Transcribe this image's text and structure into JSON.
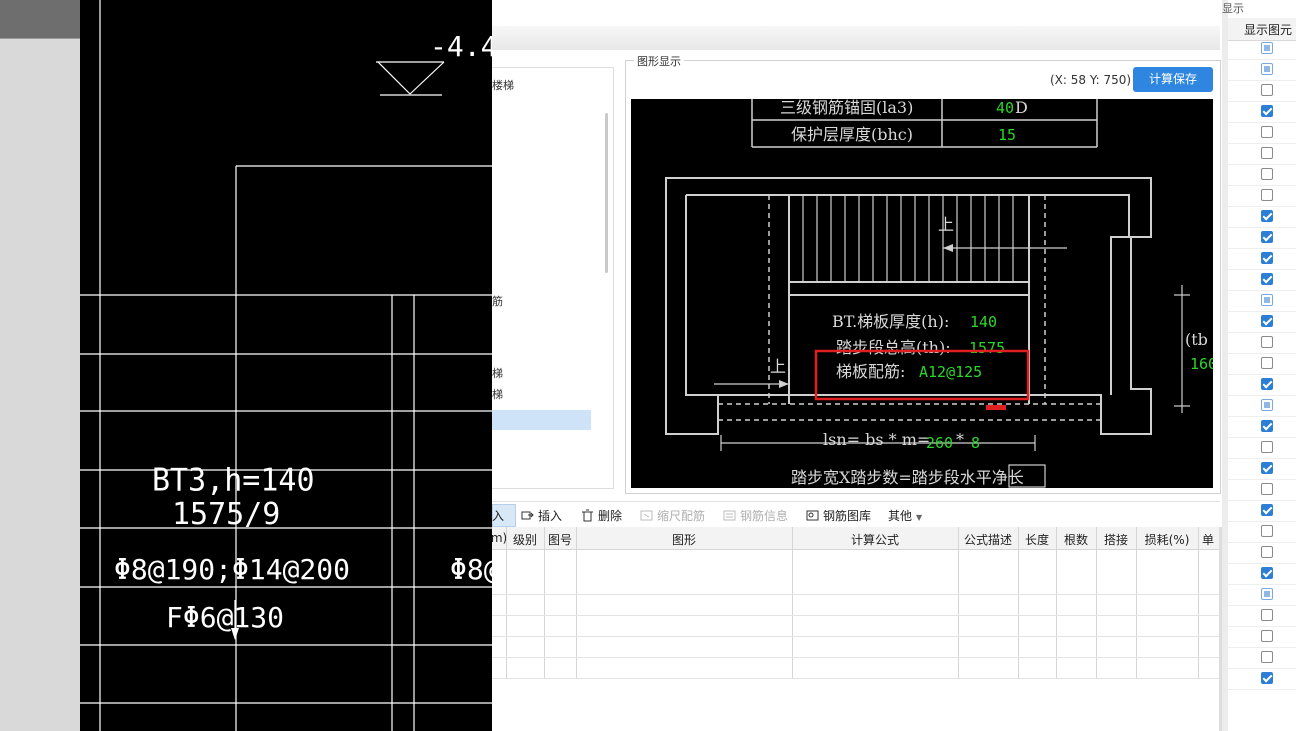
{
  "cad": {
    "elev": "-4.40",
    "label_bt": "BT3,h=140",
    "label_ratio": "1575/9",
    "label_rebar1": "Φ8@190;Φ14@200",
    "label_rebar2": "FΦ6@130",
    "label_rebar3": "Φ8@"
  },
  "tree": {
    "items": [
      "楼梯",
      "筋",
      "梯",
      "梯"
    ]
  },
  "graph": {
    "legend": "图形显示",
    "coords": "(X: 58 Y: 750)",
    "save_button": "计算保存",
    "table_row1_label": "三级钢筋锚固(la3)",
    "table_row1_value": "40",
    "table_row1_unit": "D",
    "table_row2_label": "保护层厚度(bhc)",
    "table_row2_value": "15",
    "up_label_top": "上",
    "up_label_left": "上",
    "thickness_label": "BT.梯板厚度(h):",
    "thickness_value": "140",
    "height_label": "踏步段总高(th):",
    "height_value": "1575",
    "rebar_label": "梯板配筋:",
    "rebar_value": "A12@125",
    "lsn_label": "lsn= bs * m=",
    "lsn_value1": "260",
    "lsn_value2": "8",
    "formula_bottom": "踏步宽X踏步数=踏步段水平净长",
    "right_label": "(tb",
    "right_value": "160"
  },
  "toolbar": {
    "insert_row": "入",
    "insert": "插入",
    "delete": "删除",
    "scale_rebar": "缩尺配筋",
    "rebar_info": "钢筋信息",
    "rebar_library": "钢筋图库",
    "other": "其他"
  },
  "grid": {
    "headers": [
      "m)",
      "级别",
      "图号",
      "图形",
      "计算公式",
      "公式描述",
      "长度",
      "根数",
      "搭接",
      "损耗(%)",
      "单"
    ]
  },
  "right_panel": {
    "top_label": "显示",
    "header": "显示图元",
    "checkboxes": [
      "p",
      "p",
      "e",
      "c",
      "e",
      "e",
      "e",
      "e",
      "c",
      "c",
      "c",
      "c",
      "p",
      "c",
      "e",
      "e",
      "c",
      "p",
      "c",
      "e",
      "c",
      "e",
      "c",
      "e",
      "e",
      "c",
      "p",
      "e",
      "e",
      "e",
      "c"
    ]
  },
  "colors": {
    "accent": "#2f86e0",
    "highlight_box": "#e02020",
    "value_green": "#2bd62b"
  }
}
